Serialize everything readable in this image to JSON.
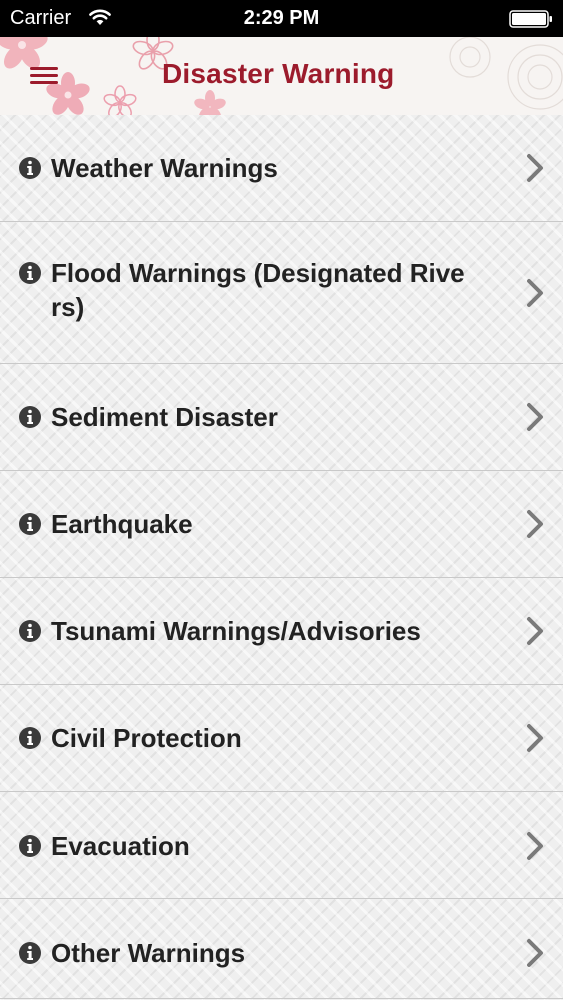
{
  "status_bar": {
    "carrier": "Carrier",
    "time": "2:29 PM"
  },
  "nav": {
    "title": "Disaster Warning",
    "menu_icon": "hamburger-icon",
    "title_color": "#9c1b2c"
  },
  "items": [
    {
      "label": "Weather Warnings",
      "icon": "info-icon"
    },
    {
      "label": "Flood Warnings (Designated Rivers)",
      "icon": "info-icon"
    },
    {
      "label": "Sediment Disaster",
      "icon": "info-icon"
    },
    {
      "label": "Earthquake",
      "icon": "info-icon"
    },
    {
      "label": "Tsunami Warnings/Advisories",
      "icon": "info-icon"
    },
    {
      "label": "Civil Protection",
      "icon": "info-icon"
    },
    {
      "label": "Evacuation",
      "icon": "info-icon"
    },
    {
      "label": "Other Warnings",
      "icon": "info-icon"
    }
  ]
}
